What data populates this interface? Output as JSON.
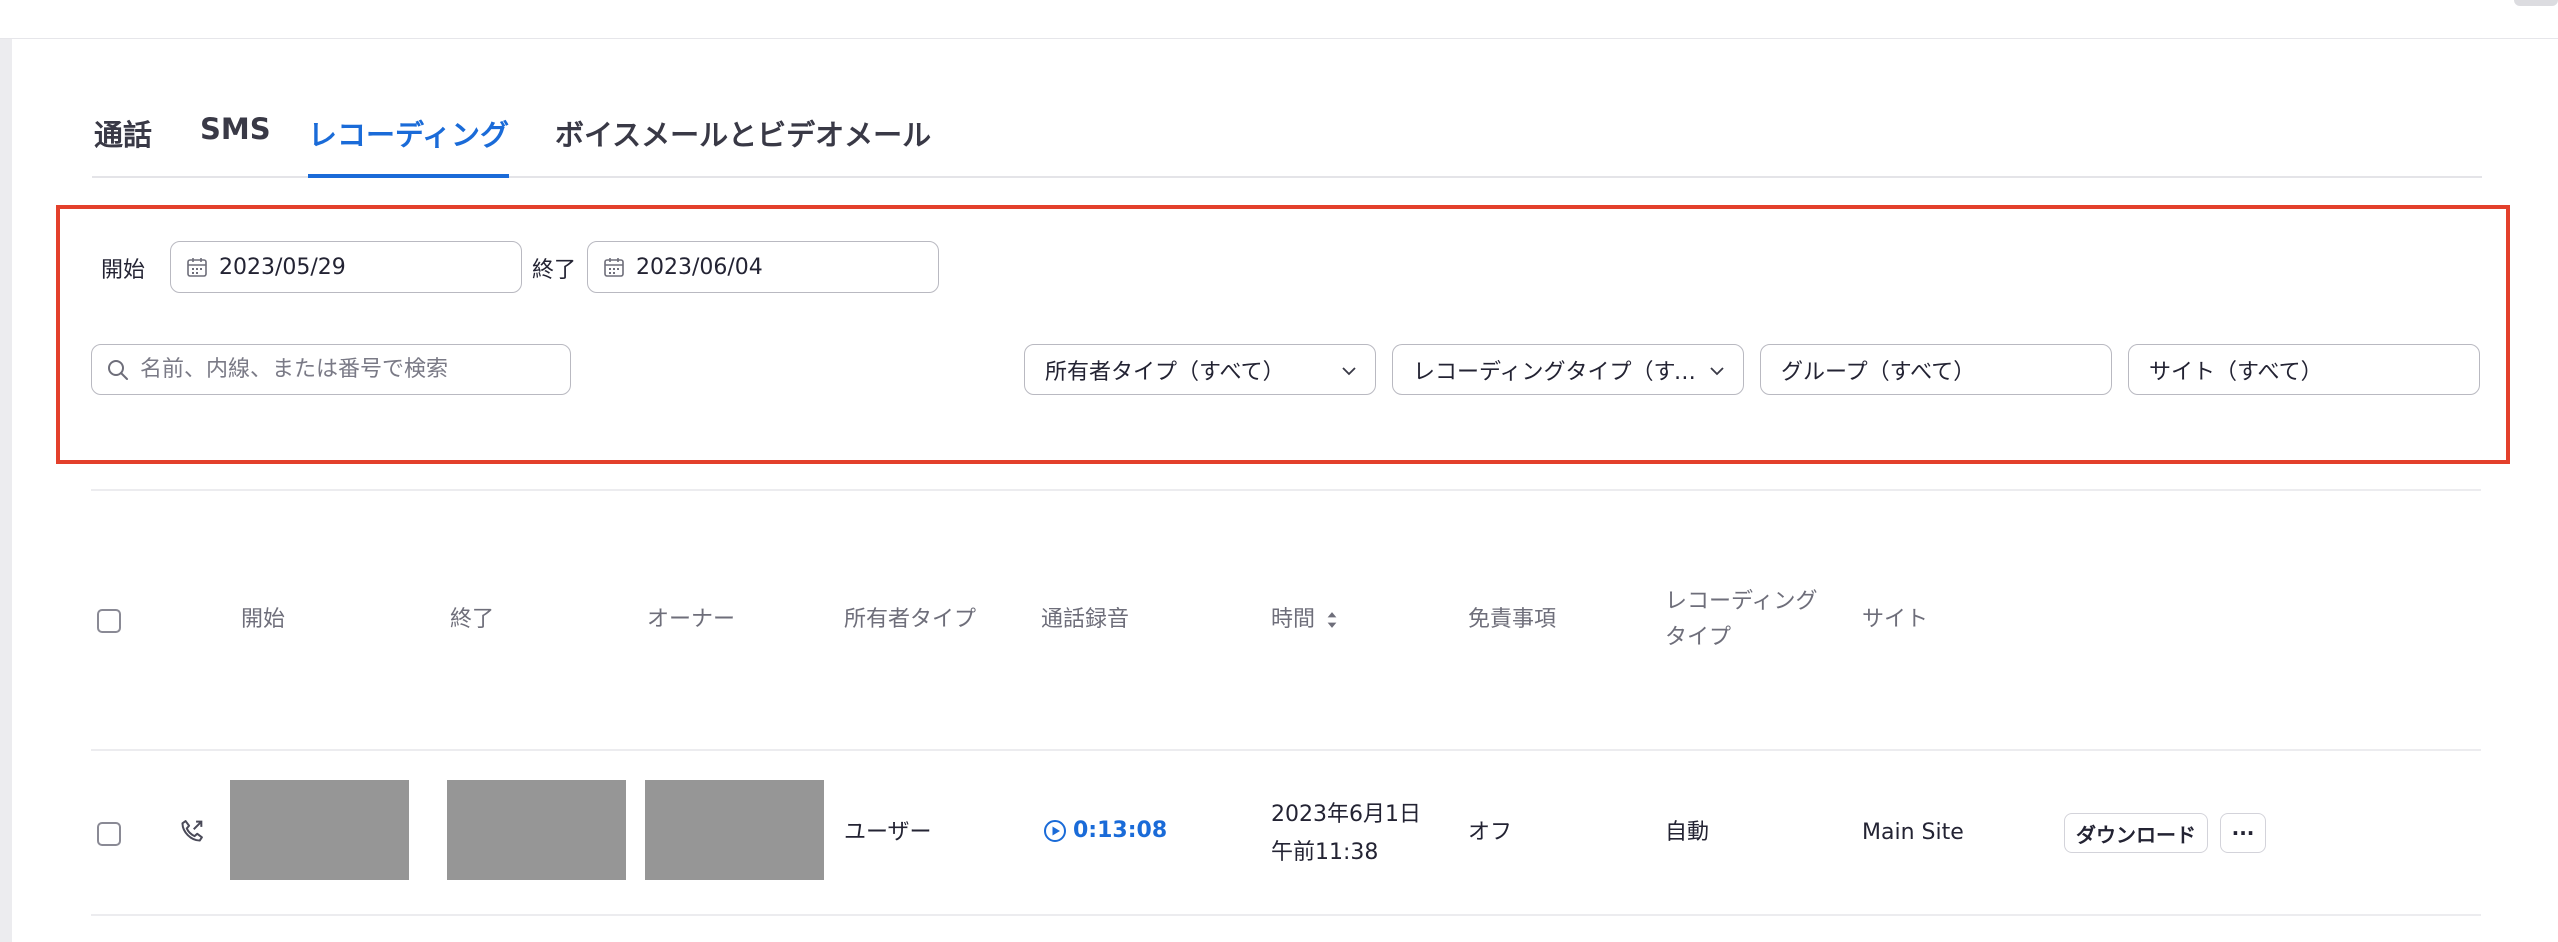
{
  "tabs": [
    {
      "label": "通話"
    },
    {
      "label": "SMS"
    },
    {
      "label": "レコーディング"
    },
    {
      "label": "ボイスメールとビデオメール"
    }
  ],
  "filters": {
    "start_label": "開始",
    "start_date": "2023/05/29",
    "end_label": "終了",
    "end_date": "2023/06/04",
    "search_placeholder": "名前、内線、または番号で検索",
    "owner_type": "所有者タイプ（すべて）",
    "recording_type": "レコーディングタイプ（すべて）",
    "group": "グループ（すべて）",
    "site": "サイト（すべて）"
  },
  "table": {
    "headers": {
      "start": "開始",
      "end": "終了",
      "owner": "オーナー",
      "owner_type": "所有者タイプ",
      "call_recording": "通話録音",
      "duration": "時間",
      "disclaimer": "免責事項",
      "recording_type_line1": "レコーディング",
      "recording_type_line2": "タイプ",
      "site": "サイト"
    },
    "rows": [
      {
        "owner_type": "ユーザー",
        "recording_duration": "0:13:08",
        "time_date": "2023年6月1日",
        "time_clock": "午前11:38",
        "disclaimer": "オフ",
        "recording_type": "自動",
        "site": "Main Site",
        "download_label": "ダウンロード",
        "more_label": "···"
      }
    ]
  },
  "colors": {
    "accent": "#1a6bd8",
    "highlight_border": "#e3402b",
    "redacted": "#969696"
  },
  "icons": {
    "calendar": "calendar-icon",
    "search": "search-icon",
    "chevron": "chevron-down-icon",
    "sort": "sort-icon",
    "phone": "outgoing-call-icon",
    "play": "play-icon"
  }
}
